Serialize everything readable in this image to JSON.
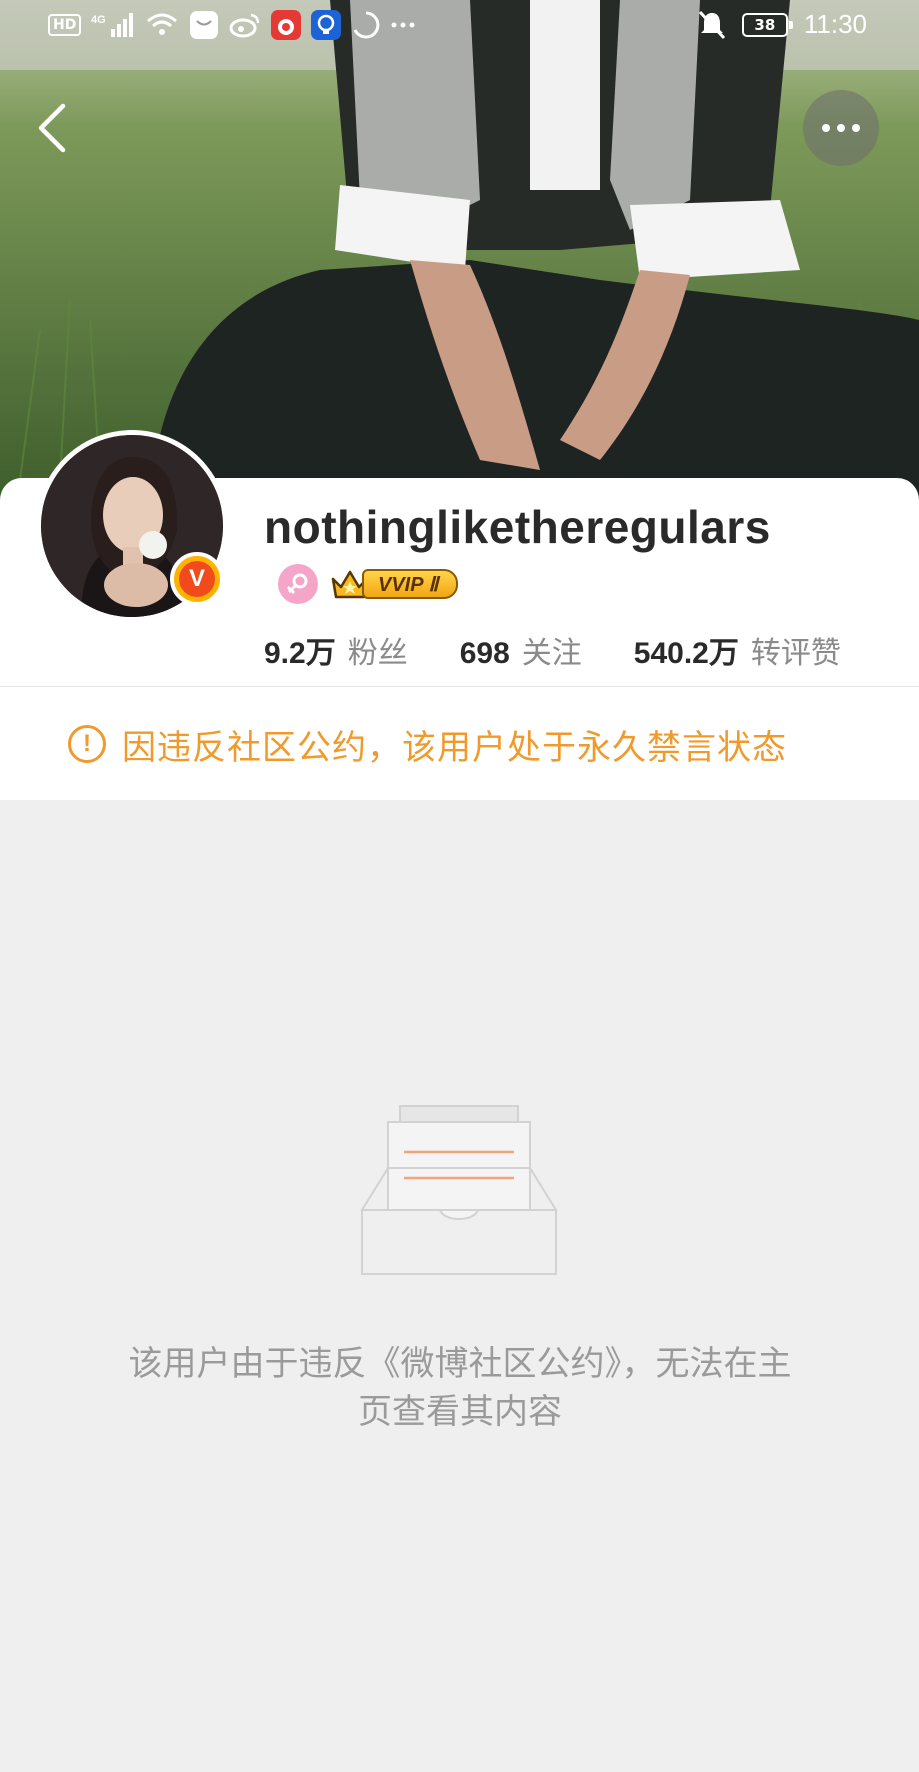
{
  "status_bar": {
    "network_label": "HD",
    "signal_label": "4G",
    "battery_level": "38",
    "time": "11:30",
    "icons": [
      "hd-icon",
      "signal-icon",
      "wifi-icon",
      "message-icon",
      "weibo-icon",
      "app-icon",
      "bulb-icon",
      "loading-icon",
      "more-notifications-icon",
      "mute-icon",
      "battery-icon"
    ]
  },
  "nav": {
    "back_icon": "chevron-left-icon",
    "more_icon": "ellipsis-icon"
  },
  "profile": {
    "username": "nothingliketheregulars",
    "verified_mark": "V",
    "gender_icon": "female-icon",
    "vip_label": "VVIP Ⅱ",
    "stats": [
      {
        "value": "9.2万",
        "label": "粉丝"
      },
      {
        "value": "698",
        "label": "关注"
      },
      {
        "value": "540.2万",
        "label": "转评赞"
      }
    ]
  },
  "notice": {
    "icon": "!",
    "text": "因违反社区公约，该用户处于永久禁言状态",
    "color": "#f09a2c"
  },
  "empty_state": {
    "illustration": "empty-box-icon",
    "message_line1": "该用户由于违反《微博社区公约》，无法在主",
    "message_line2": "页查看其内容"
  }
}
